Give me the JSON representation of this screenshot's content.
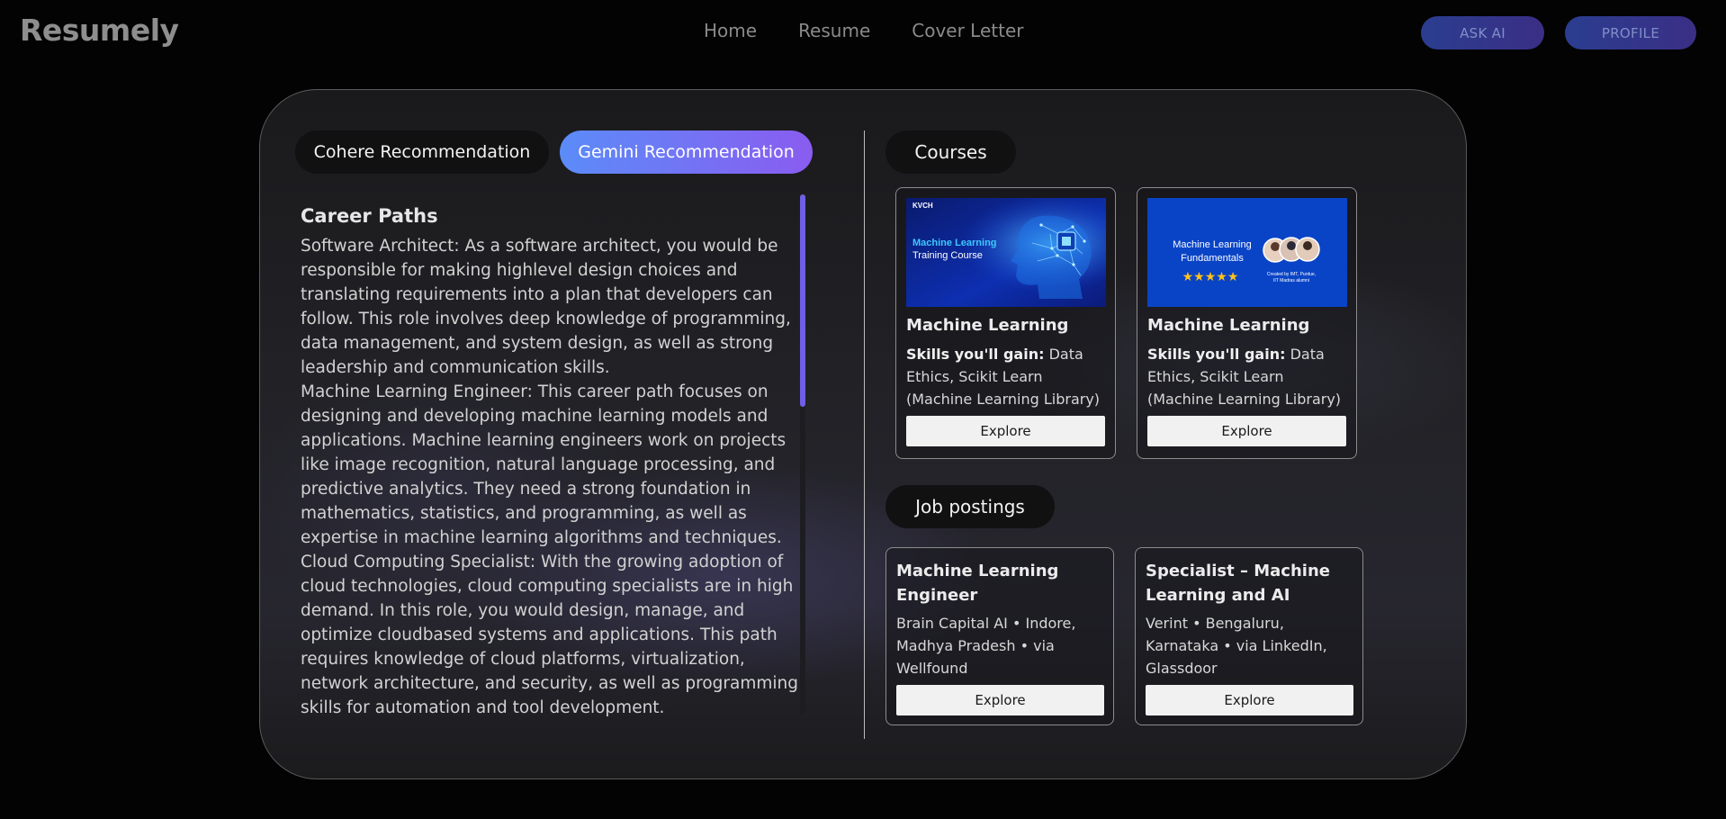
{
  "header": {
    "brand": "Resumely",
    "nav": [
      "Home",
      "Resume",
      "Cover Letter"
    ],
    "ask_ai": "ASK AI",
    "profile": "PROFILE"
  },
  "tabs": {
    "cohere": "Cohere Recommendation",
    "gemini": "Gemini Recommendation",
    "active": "gemini"
  },
  "career": {
    "title": "Career Paths",
    "paragraphs": [
      "Software Architect: As a software architect, you would be responsible for making highlevel design choices and translating requirements into a plan that developers can follow. This role involves deep knowledge of programming, data management, and system design, as well as strong leadership and communication skills.",
      "Machine Learning Engineer: This career path focuses on designing and developing machine learning models and applications. Machine learning engineers work on projects like image recognition, natural language processing, and predictive analytics. They need a strong foundation in mathematics, statistics, and programming, as well as expertise in machine learning algorithms and techniques.",
      "Cloud Computing Specialist: With the growing adoption of cloud technologies, cloud computing specialists are in high demand. In this role, you would design, manage, and optimize cloudbased systems and applications. This path requires knowledge of cloud platforms, virtualization, network architecture, and security, as well as programming skills for automation and tool development."
    ]
  },
  "courses": {
    "heading": "Courses",
    "items": [
      {
        "title": "Machine Learning",
        "skills_label": "Skills you'll gain:",
        "skills": "Data Ethics, Scikit Learn (Machine Learning Library)",
        "explore": "Explore",
        "thumb": {
          "brand": "KVCH",
          "line1": "Machine Learning",
          "line2": "Training Course"
        }
      },
      {
        "title": "Machine Learning",
        "skills_label": "Skills you'll gain:",
        "skills": "Data Ethics, Scikit Learn (Machine Learning Library)",
        "explore": "Explore",
        "thumb": {
          "line1": "Machine Learning",
          "line2": "Fundamentals",
          "caption1": "Created by IMT, Purdue,",
          "caption2": "IIT Madras alumni",
          "stars": "★★★★★"
        }
      }
    ]
  },
  "jobs": {
    "heading": "Job postings",
    "items": [
      {
        "title": "Machine Learning Engineer",
        "meta": "Brain Capital AI • Indore, Madhya Pradesh • via Wellfound",
        "explore": "Explore"
      },
      {
        "title": "Specialist – Machine Learning and AI",
        "meta": "Verint • Bengaluru, Karnataka • via LinkedIn, Glassdoor",
        "explore": "Explore"
      }
    ]
  },
  "colors": {
    "accent_start": "#5b8cf8",
    "accent_end": "#8a5cf0",
    "scrollbar": "#6f5fe4"
  }
}
